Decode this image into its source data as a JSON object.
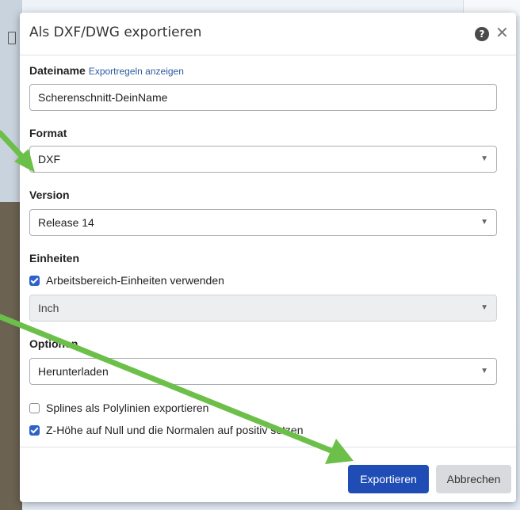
{
  "dialog": {
    "title": "Als DXF/DWG exportieren",
    "filename_label": "Dateiname",
    "export_rules_link": "Exportregeln anzeigen",
    "filename_value": "Scherenschnitt-DeinName",
    "format_label": "Format",
    "format_value": "DXF",
    "version_label": "Version",
    "version_value": "Release 14",
    "units_label": "Einheiten",
    "use_workspace_units_label": "Arbeitsbereich-Einheiten verwenden",
    "use_workspace_units_checked": true,
    "units_value": "Inch",
    "options_label": "Optionen",
    "options_value": "Herunterladen",
    "splines_label": "Splines als Polylinien exportieren",
    "splines_checked": false,
    "zheight_label": "Z-Höhe auf Null und die Normalen auf positiv setzen",
    "zheight_checked": true,
    "export_button": "Exportieren",
    "cancel_button": "Abbrechen"
  },
  "icons": {
    "help": "help-icon",
    "close": "close-icon",
    "dropdown": "chevron-down-icon"
  },
  "colors": {
    "primary_button": "#1f4db5",
    "checkbox_checked": "#2d62c8",
    "annotation_arrow": "#6cc04a"
  }
}
